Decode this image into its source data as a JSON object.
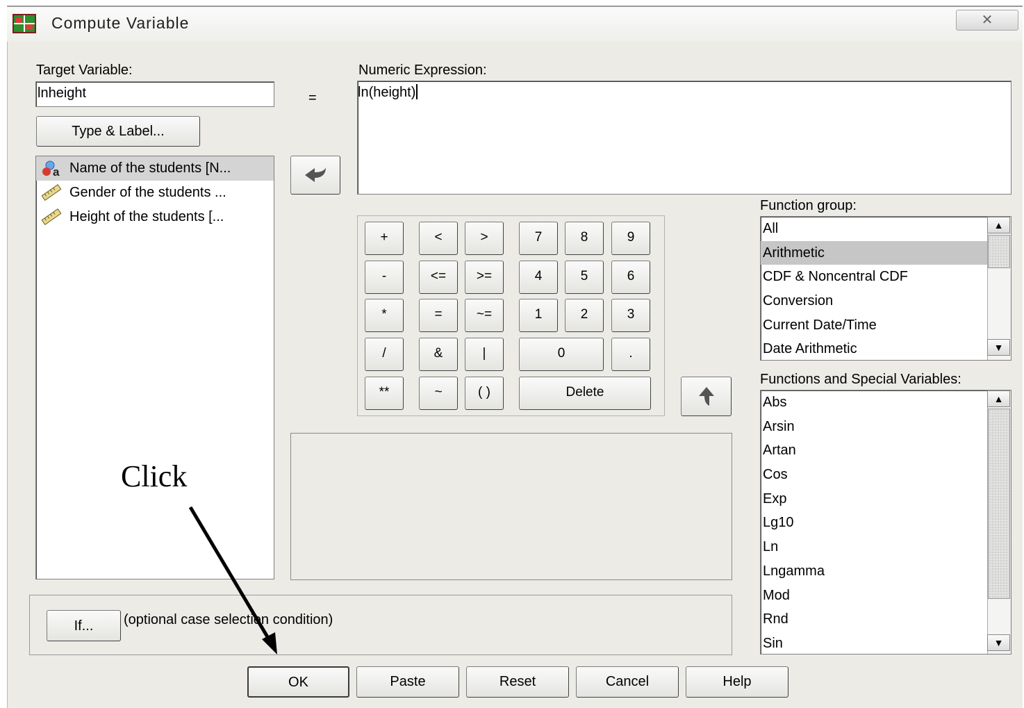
{
  "window": {
    "title": "Compute Variable",
    "close_glyph": "☒"
  },
  "target": {
    "label": "Target Variable:",
    "value": "lnheight",
    "equals": "="
  },
  "type_label_button": "Type & Label...",
  "expression": {
    "label": "Numeric Expression:",
    "value": "ln(height)"
  },
  "variables": [
    {
      "label": "Name of the students [N...",
      "icon": "string-variable-icon"
    },
    {
      "label": "Gender of the students ...",
      "icon": "scale-variable-icon"
    },
    {
      "label": "Height of the students [...",
      "icon": "scale-variable-icon"
    }
  ],
  "keypad": {
    "row1": [
      "+",
      "<",
      ">",
      "7",
      "8",
      "9"
    ],
    "row2": [
      "-",
      "<=",
      ">=",
      "4",
      "5",
      "6"
    ],
    "row3": [
      "*",
      "=",
      "~=",
      "1",
      "2",
      "3"
    ],
    "row4": [
      "/",
      "&",
      "|",
      "0",
      "."
    ],
    "row5": [
      "**",
      "~",
      "( )",
      "Delete"
    ]
  },
  "function_group": {
    "label": "Function group:",
    "items": [
      "All",
      "Arithmetic",
      "CDF & Noncentral CDF",
      "Conversion",
      "Current Date/Time",
      "Date Arithmetic"
    ],
    "selected": "Arithmetic"
  },
  "functions": {
    "label": "Functions and Special Variables:",
    "items": [
      "Abs",
      "Arsin",
      "Artan",
      "Cos",
      "Exp",
      "Lg10",
      "Ln",
      "Lngamma",
      "Mod",
      "Rnd",
      "Sin"
    ]
  },
  "if_section": {
    "button": "If...",
    "text": "(optional case selection condition)"
  },
  "buttons": {
    "ok": "OK",
    "paste": "Paste",
    "reset": "Reset",
    "cancel": "Cancel",
    "help": "Help"
  },
  "annotation": {
    "text": "Click"
  },
  "colors": {
    "selection": "#c6c6c6",
    "dialog_bg": "#ecebe6"
  }
}
